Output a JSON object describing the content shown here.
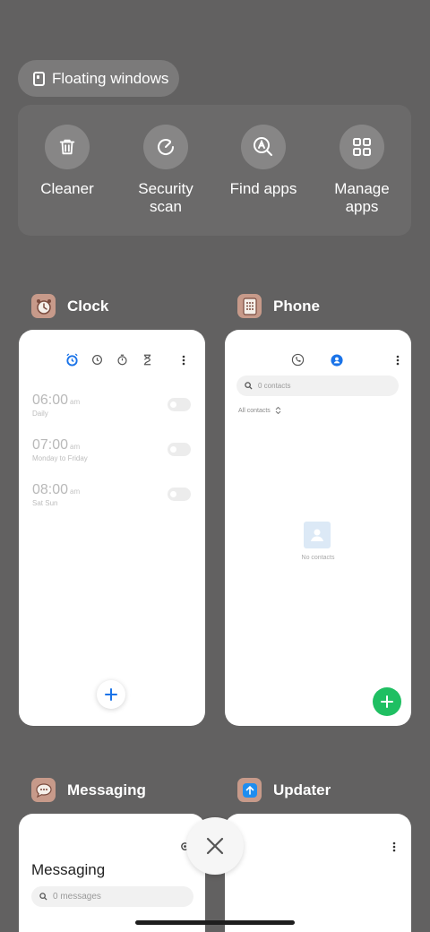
{
  "floating_windows": {
    "label": "Floating windows",
    "icon": "floating-window-icon"
  },
  "tools": [
    {
      "label": "Cleaner",
      "icon": "trash-icon"
    },
    {
      "label": "Security\nscan",
      "icon": "security-scan-icon"
    },
    {
      "label": "Find apps",
      "icon": "find-apps-icon"
    },
    {
      "label": "Manage\napps",
      "icon": "grid-icon"
    }
  ],
  "apps": {
    "clock": {
      "name": "Clock",
      "icon": "alarm-clock-icon",
      "alarms": [
        {
          "time": "06:00",
          "ampm": "am",
          "repeat": "Daily"
        },
        {
          "time": "07:00",
          "ampm": "am",
          "repeat": "Monday to Friday"
        },
        {
          "time": "08:00",
          "ampm": "am",
          "repeat": "Sat Sun"
        }
      ]
    },
    "phone": {
      "name": "Phone",
      "icon": "phone-keypad-icon",
      "search_placeholder": "0 contacts",
      "sort_label": "All contacts",
      "empty_text": "No contacts"
    },
    "messaging": {
      "name": "Messaging",
      "icon": "messaging-icon",
      "title": "Messaging",
      "search_placeholder": "0 messages"
    },
    "updater": {
      "name": "Updater",
      "icon": "updater-icon"
    }
  },
  "colors": {
    "background": "#626161",
    "accent_blue": "#1a73e8",
    "fab_green": "#1fbf62"
  }
}
